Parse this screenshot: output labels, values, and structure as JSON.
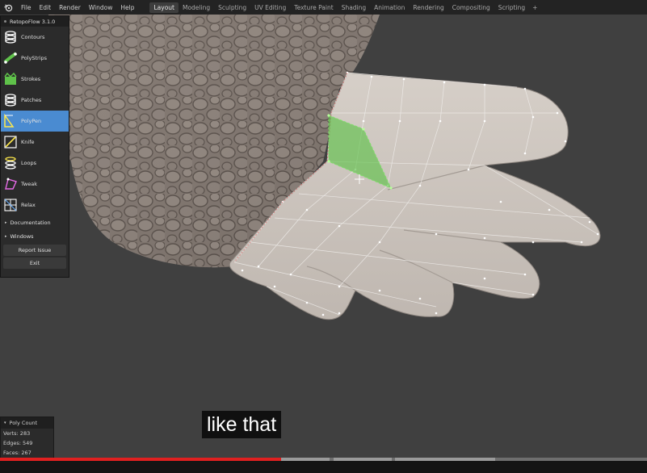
{
  "topbar": {
    "menus": [
      "File",
      "Edit",
      "Render",
      "Window",
      "Help"
    ],
    "tabs": [
      "Layout",
      "Modeling",
      "Sculpting",
      "UV Editing",
      "Texture Paint",
      "Shading",
      "Animation",
      "Rendering",
      "Compositing",
      "Scripting"
    ],
    "active_tab": "Layout",
    "add_tab_icon": "plus-icon"
  },
  "retopoflow": {
    "title": "RetopoFlow 3.1.0",
    "tools": [
      {
        "label": "Contours",
        "icon": "contours-icon",
        "active": false
      },
      {
        "label": "PolyStrips",
        "icon": "polystrips-icon",
        "active": false
      },
      {
        "label": "Strokes",
        "icon": "strokes-icon",
        "active": false
      },
      {
        "label": "Patches",
        "icon": "patches-icon",
        "active": false
      },
      {
        "label": "PolyPen",
        "icon": "polypen-icon",
        "active": true
      },
      {
        "label": "Knife",
        "icon": "knife-icon",
        "active": false
      },
      {
        "label": "Loops",
        "icon": "loops-icon",
        "active": false
      },
      {
        "label": "Tweak",
        "icon": "tweak-icon",
        "active": false
      },
      {
        "label": "Relax",
        "icon": "relax-icon",
        "active": false
      }
    ],
    "sections": [
      "Documentation",
      "Windows"
    ],
    "buttons": [
      "Report Issue",
      "Exit"
    ]
  },
  "poly_count": {
    "title": "Poly Count",
    "rows": [
      "Verts: 283",
      "Edges: 549",
      "Faces: 267"
    ]
  },
  "caption": "like that",
  "video": {
    "progress": 0.435,
    "buffered_segments": [
      [
        0.435,
        0.51
      ],
      [
        0.515,
        0.605
      ],
      [
        0.61,
        0.765
      ]
    ]
  },
  "colors": {
    "accent": "#4a8bd1",
    "progress_red": "#e02020",
    "mesh_green": "#5fc24a",
    "skin": "#cdc4bc"
  }
}
